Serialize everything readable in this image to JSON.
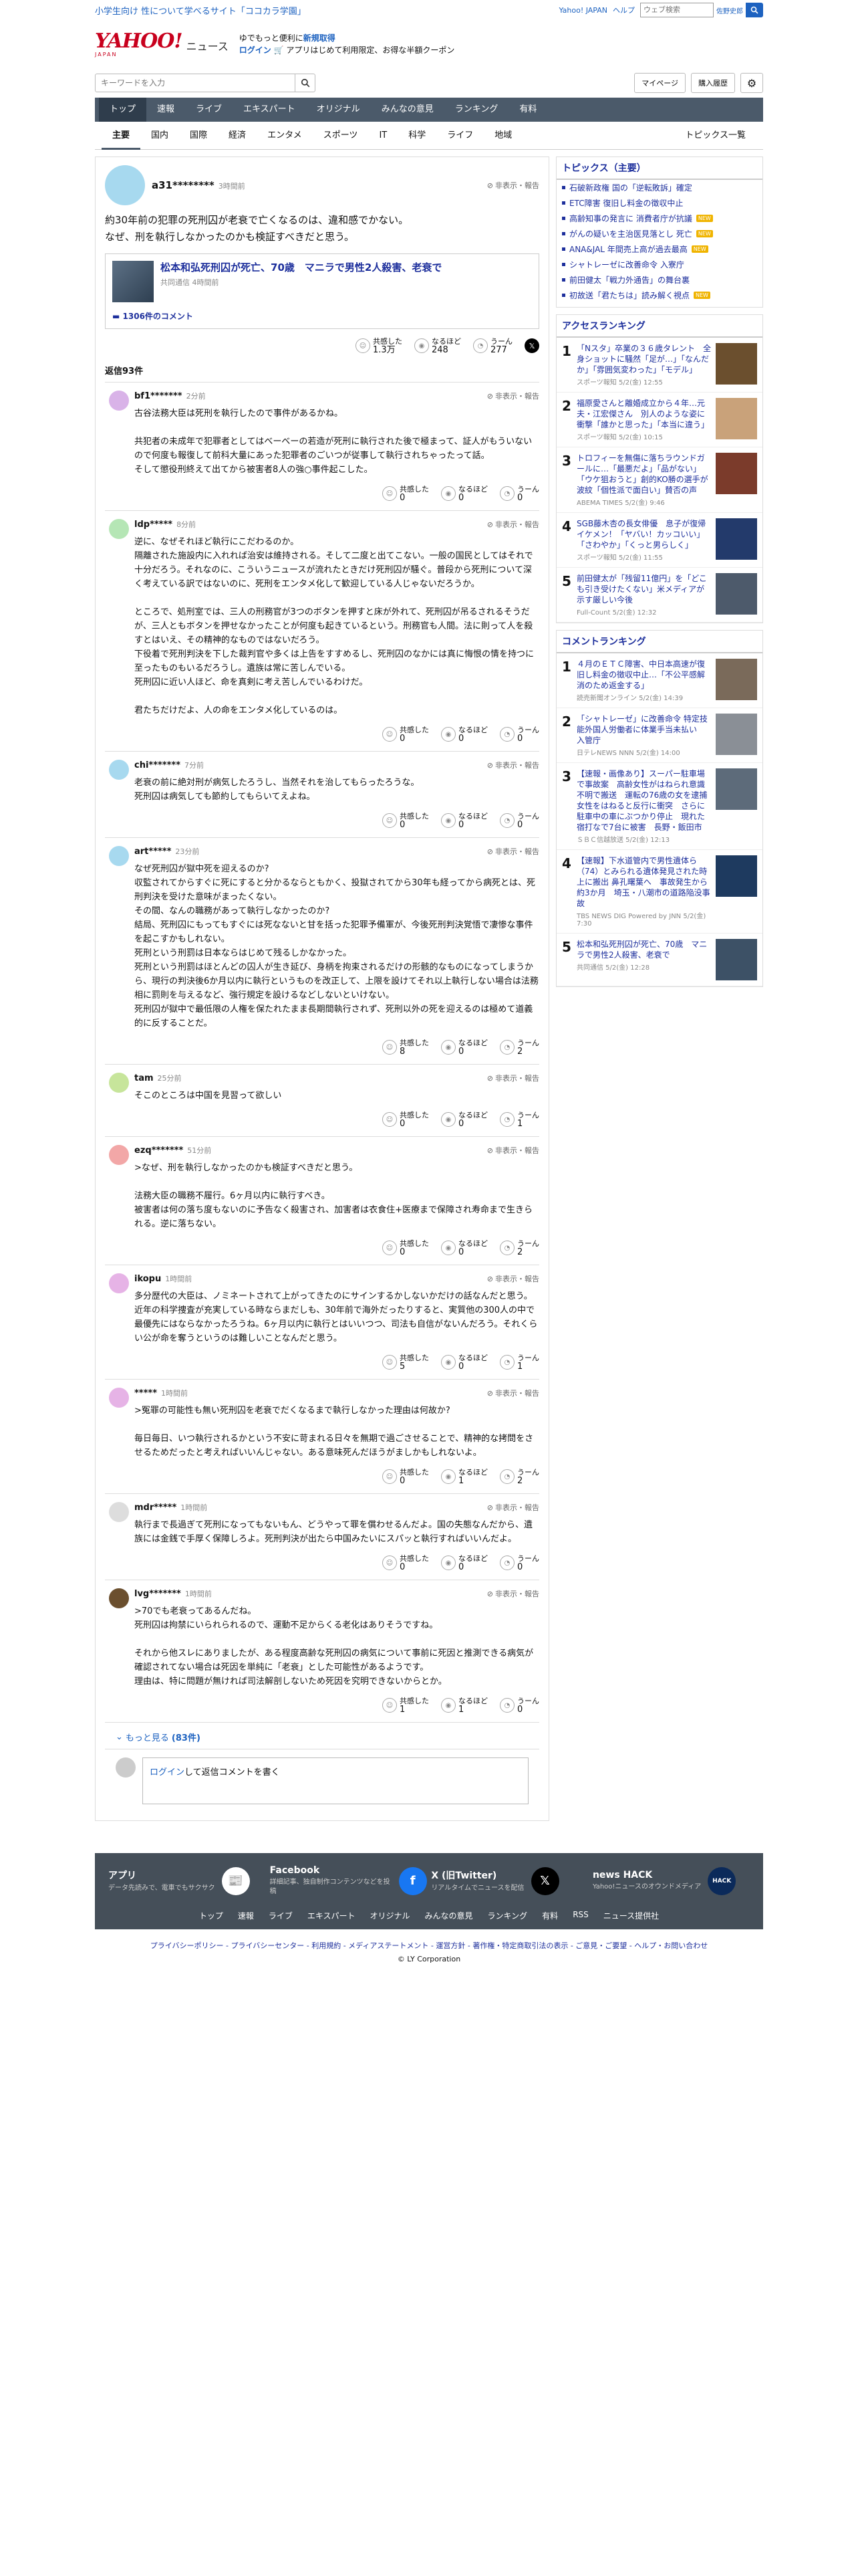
{
  "topbar": {
    "promo": "小学生向け 性について学べるサイト「ココカラ学園」",
    "links": [
      "Yahoo! JAPAN",
      "ヘルプ"
    ],
    "web_search_placeholder": "ウェブ検索",
    "user": "佐野史郎"
  },
  "header": {
    "logo_main": "YAHOO!",
    "logo_sub": "JAPAN",
    "logo_news": "ニュース",
    "promo_line1_pre": "ゆでもっと便利に",
    "promo_line1_bold": "新規取得",
    "promo_line2_login": "ログイン",
    "promo_line2_rest": "🛒 アプリはじめて利用限定、お得な半額クーポン"
  },
  "search": {
    "placeholder": "キーワードを入力",
    "mypage": "マイページ",
    "history": "購入履歴"
  },
  "nav": {
    "tabs": [
      "トップ",
      "速報",
      "ライブ",
      "エキスパート",
      "オリジナル",
      "みんなの意見",
      "ランキング",
      "有料"
    ],
    "subtabs": [
      "主要",
      "国内",
      "国際",
      "経済",
      "エンタメ",
      "スポーツ",
      "IT",
      "科学",
      "ライフ",
      "地域"
    ],
    "topics_list": "トピックス一覧"
  },
  "article": {
    "user": "a31********",
    "time": "3時間前",
    "report": "非表示・報告",
    "comment": "約30年前の犯罪の死刑囚が老衰で亡くなるのは、違和感でかない。\nなぜ、刑を執行しなかったのかも検証すべきだと思う。",
    "card_title": "松本和弘死刑囚が死亡、70歳　マニラで男性2人殺害、老衰で",
    "card_src": "共同通信 4時間前",
    "card_comments": "1306件のコメント",
    "reactions": [
      {
        "label": "共感した",
        "value": "1.3万"
      },
      {
        "label": "なるほど",
        "value": "248"
      },
      {
        "label": "うーん",
        "value": "277"
      }
    ],
    "reply_count": "返信93件"
  },
  "comments": [
    {
      "user": "bf1*******",
      "time": "2分前",
      "text": "古谷法務大臣は死刑を執行したので事件があるかね。\n\n共犯者の未成年で犯罪者としてはべーべーの若造が死刑に執行された後で極まって、証人がもういないので何度も報復して前科大量にあった犯罪者のごいつが従事して執行されちゃったって話。\nそして懲役刑終えて出てから被害者8人の強○事件起こした。",
      "r": [
        "0",
        "0",
        "0"
      ],
      "color": "#d9b3e8"
    },
    {
      "user": "ldp*****",
      "time": "8分前",
      "text": "逆に、なぜそれほど執行にこだわるのか。\n隔離された施設内に入れれば治安は維持される。そして二度と出てこない。一般の国民としてはそれで十分だろう。それなのに、こういうニュースが流れたときだけ死刑囚が騒ぐ。普段から死刑について深く考えている訳ではないのに、死刑をエンタメ化して歓迎している人じゃないだろうか。\n\nところで、処刑室では、三人の刑務官が3つのボタンを押すと床が外れて、死刑囚が吊るされるそうだが、三人ともボタンを押せなかったことが何度も起きているという。刑務官も人間。法に則って人を殺すとはいえ、その精神的なものではないだろう。\n下役着で死刑判決を下した裁判官や多くは上告をすすめるし、死刑囚のなかには真に悔恨の情を持つに至ったものもいるだろうし。遺族は常に苦しんでいる。\n死刑囚に近い人ほど、命を真剣に考え苦しんでいるわけだ。\n\n君たちだけだよ、人の命をエンタメ化しているのは。",
      "r": [
        "0",
        "0",
        "0"
      ],
      "color": "#b5e6b5"
    },
    {
      "user": "chi*******",
      "time": "7分前",
      "text": "老衰の前に絶対刑が病気したろうし、当然それを治してもらったろうな。\n死刑囚は病気しても節約してもらいてえよね。",
      "r": [
        "0",
        "0",
        "0"
      ],
      "color": "#a7d9ef"
    },
    {
      "user": "art*****",
      "time": "23分前",
      "text": "なぜ死刑囚が獄中死を迎えるのか?\n収監されてからすぐに死にすると分かるならともかく、投獄されてから30年も経ってから病死とは、死刑判決を受けた意味がまったくない。\nその間、なんの職務があって執行しなかったのか?\n結局、死刑囚にもってもすぐには死なないと甘を括った犯罪予備軍が、今後死刑判決覚悟で凄惨な事件を起こすかもしれない。\n死刑という刑罰は日本ならはじめて残るしかなかった。\n死刑という刑罰はほとんどの囚人が生き延び、身柄を拘束されるだけの形骸的なものになってしまうから、現行の判決後6か月以内に執行というものを改正して、上限を設けてそれ以上執行しない場合は法務相に罰則を与えるなど、強行規定を設けるなどしないといけない。\n死刑囚が獄中で最低限の人権を保たれたまま長期間執行されず、死刑以外の死を迎えるのは極めて道義的に反することだ。",
      "r": [
        "8",
        "0",
        "2"
      ],
      "color": "#a7d9ef"
    },
    {
      "user": "tam",
      "time": "25分前",
      "text": "そこのところは中国を見習って欲しい",
      "r": [
        "0",
        "0",
        "1"
      ],
      "color": "#c7e59b"
    },
    {
      "user": "ezq*******",
      "time": "51分前",
      "text": ">なぜ、刑を執行しなかったのかも検証すべきだと思う。\n\n法務大臣の職務不履行。6ヶ月以内に執行すべき。\n被害者は何の落ち度もないのに予告なく殺害され、加害者は衣食住+医療まで保障され寿命まで生きられる。逆に落ちない。",
      "r": [
        "0",
        "0",
        "2"
      ],
      "color": "#f2a7a7"
    },
    {
      "user": "ikopu",
      "time": "1時間前",
      "text": "多分歴代の大臣は、ノミネートされて上がってきたのにサインするかしないかだけの話なんだと思う。近年の科学捜査が充実している時ならまだしも、30年前で海外だったりすると、実質他の300人の中で最優先にはならなかったろうね。6ヶ月以内に執行とはいいつつ、司法も自信がないんだろう。それくらい公が命を奪うというのは難しいことなんだと思う。",
      "r": [
        "5",
        "0",
        "1"
      ],
      "color": "#e6b3e6"
    },
    {
      "user": "*****",
      "time": "1時間前",
      "text": ">冤罪の可能性も無い死刑囚を老衰でだくなるまで執行しなかった理由は何故か?\n\n毎日毎日、いつ執行されるかという不安に苛まれる日々を無期で過ごさせることで、精神的な拷問をさせるためだったと考えればいいんじゃない。ある意味死んだほうがましかもしれないよ。",
      "r": [
        "0",
        "1",
        "2"
      ],
      "color": "#e6b3e6"
    },
    {
      "user": "mdr*****",
      "time": "1時間前",
      "text": "執行まで長過ぎて死刑になってもないもん、どうやって罪を償わせるんだよ。国の失態なんだから、遺族には金銭で手厚く保障しろよ。死刑判決が出たら中国みたいにスパッと執行すればいいんだよ。",
      "r": [
        "0",
        "0",
        "0"
      ],
      "color": "#dddddd"
    },
    {
      "user": "lvg*******",
      "time": "1時間前",
      "text": ">70でも老衰ってあるんだね。\n死刑囚は拘禁にいられられるので、運動不足からくる老化はありそうですね。\n\nそれから他スレにありましたが、ある程度高齢な死刑囚の病気について事前に死因と推測できる病気が確認されてない場合は死因を単純に「老衰」とした可能性があるようです。\n理由は、特に問題が無ければ司法解剖しないため死因を究明できないからとか。",
      "r": [
        "1",
        "1",
        "0"
      ],
      "color": "#6b4f2e"
    }
  ],
  "more_replies": {
    "label": "もっと見る",
    "count": "(83件)"
  },
  "reply_box": {
    "login": "ログイン",
    "rest": "して返信コメントを書く"
  },
  "sidebar": {
    "topics_title": "トピックス（主要）",
    "topics": [
      {
        "t": "石破新政権 国の「逆転敗訴」確定",
        "badge": ""
      },
      {
        "t": "ETC障害 復旧し料金の徴収中止",
        "badge": ""
      },
      {
        "t": "高齢知事の発言に 消費者庁が抗議",
        "badge": "NEW"
      },
      {
        "t": "がんの疑いを主治医見落とし 死亡",
        "badge": "NEW"
      },
      {
        "t": "ANA&JAL 年間売上高が過去最高",
        "badge": "NEW"
      },
      {
        "t": "シャトレーゼに改善命令 入寮庁",
        "badge": ""
      },
      {
        "t": "前田健太「戦力外通告」の舞台裏",
        "badge": ""
      },
      {
        "t": "初故送「君たちは」読み解く視点",
        "badge": "NEW"
      }
    ],
    "access_title": "アクセスランキング",
    "access": [
      {
        "n": "1",
        "t": "「Nスタ」卒業の３６歳タレント　全身ショットに騒然「足が…」「なんだか」「雰囲気変わった」「モデル」",
        "s": "スポーツ報知 5/2(金) 12:55",
        "c": "#6b4f2e"
      },
      {
        "n": "2",
        "t": "福原愛さんと離婚成立から４年…元夫・江宏傑さん　別人のような姿に衝撃「誰かと思った」「本当に違う」",
        "s": "スポーツ報知 5/2(金) 10:15",
        "c": "#c9a27a"
      },
      {
        "n": "3",
        "t": "トロフィーを無傷に落ちラウンドガールに…「最悪だよ」「品がない」「ウケ狙おうと」創的KO勝の選手が波紋「個性派で面白い」賛否の声",
        "s": "ABEMA TIMES 5/2(金) 9:46",
        "c": "#7b3b2b"
      },
      {
        "n": "4",
        "t": "SGB藤木杏の長女俳優　息子が復帰イケメン！「ヤバい！カッコいい」「さわやか」「くっと男らしく」",
        "s": "スポーツ報知 5/2(金) 11:55",
        "c": "#233a6b"
      },
      {
        "n": "5",
        "t": "前田健太が「残留11億円」を「どこも引き受けたくない」米メディアが示す厳しい今後",
        "s": "Full-Count 5/2(金) 12:32",
        "c": "#4d5a6b"
      }
    ],
    "comment_title": "コメントランキング",
    "comment_rank": [
      {
        "n": "1",
        "t": "４月のＥＴＣ障害、中日本高速が復旧し料金の徴収中止…「不公平感解消のため返金する」",
        "s": "読売新聞オンライン 5/2(金) 14:39",
        "c": "#7a6a5a"
      },
      {
        "n": "2",
        "t": "「シャトレーゼ」に改善命令 特定技能外国人労働者に体業手当未払い　入管庁",
        "s": "日テレNEWS NNN 5/2(金) 14:00",
        "c": "#8a8f96"
      },
      {
        "n": "3",
        "t": "【速報・画像あり】スーパー駐車場で事故案　高齢女性がはねられ意識不明で搬送　運転の76歳の女を逮捕　女性をはねると反行に衝突　さらに駐車中の車にぶつかり停止　現れた宿打なで7台に被害　長野・飯田市",
        "s": "ＳＢＣ信越放送 5/2(金) 12:13",
        "c": "#5d6b7a"
      },
      {
        "n": "4",
        "t": "【速報】下水道管内で男性遺体ら（74）とみられる遺体発見された時上に搬出 鼻孔曙葉へ　事故発生から約3か月　埼玉・八潮市の道路陥没事故",
        "s": "TBS NEWS DIG Powered by JNN 5/2(金) 7:30",
        "c": "#1e3a5f"
      },
      {
        "n": "5",
        "t": "松本和弘死刑囚が死亡、70歳　マニラで男性2人殺害、老衰で",
        "s": "共同通信 5/2(金) 12:28",
        "c": "#3d5166"
      }
    ]
  },
  "footer": {
    "apps": [
      {
        "t": "アプリ",
        "d": "データ先読みで、電車でもサクサク",
        "icon": "📰",
        "bg": "#ffffff"
      },
      {
        "t": "Facebook",
        "d": "詳細記事、独自制作コンテンツなどを投稿",
        "icon": "f",
        "bg": "#1877f2"
      },
      {
        "t": "X (旧Twitter)",
        "d": "リアルタイムでニュースを配信",
        "icon": "𝕏",
        "bg": "#000000"
      },
      {
        "t": "news HACK",
        "d": "Yahoo!ニュースのオウンドメディア",
        "icon": "HACK",
        "bg": "#0b2a5a"
      }
    ],
    "links": [
      "トップ",
      "速報",
      "ライブ",
      "エキスパート",
      "オリジナル",
      "みんなの意見",
      "ランキング",
      "有料",
      "RSS",
      "ニュース提供社"
    ],
    "legal": "プライバシーポリシー - プライバシーセンター - 利用規約 - メディアステートメント - 運営方針 - 著作権・特定商取引法の表示 - ご意見・ご要望 - ヘルプ・お問い合わせ",
    "copyright": "© LY Corporation"
  }
}
